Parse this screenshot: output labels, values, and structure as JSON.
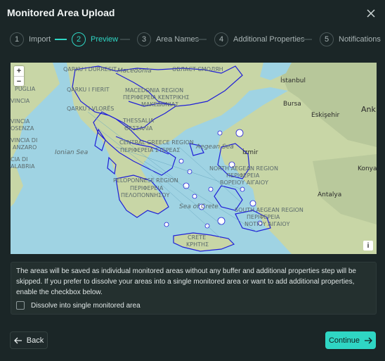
{
  "modal": {
    "title": "Monitored Area Upload"
  },
  "steps": [
    {
      "number": "1",
      "label": "Import",
      "state": "done"
    },
    {
      "number": "2",
      "label": "Preview",
      "state": "active"
    },
    {
      "number": "3",
      "label": "Area Names",
      "state": "pending"
    },
    {
      "number": "4",
      "label": "Additional Properties",
      "state": "pending"
    },
    {
      "number": "5",
      "label": "Notifications",
      "state": "pending"
    }
  ],
  "map": {
    "zoom_in": "+",
    "zoom_out": "−",
    "info": "i",
    "labels": {
      "qarku_durresit": "QARKU I DURRESIT",
      "macedonia": "Macedonia",
      "oblast": "ОБЛАСТ СМОЛЯН",
      "istanbul": "İstanbul",
      "puglia": "PUGLIA",
      "qarku_fierit": "QARKU I FIERIT",
      "macedonia_region": "MACEDONIA REGION",
      "peripheria_kentrikis": "ΠΕΡΙΦΕΡΕΙΑ ΚΕΝΤΡΙΚΗΣ",
      "makedonias": "ΜΑΚΕΔΟΝΙΑΣ",
      "bursa": "Bursa",
      "ankara": "Ank",
      "vincia": "VINCIA",
      "qarku_vlores": "QARKU I VLORËS",
      "eskisehir": "Eskişehir",
      "vincia_ta": "VINCIA",
      "osenza": "OSENZA",
      "thessalia": "THESSALIA",
      "thessalia_gr": "ΘΕΣΣΑΛΙΑ",
      "vincia_di": "VINCIA DI",
      "anzaro": "ANZARO",
      "ionian": "Ionian Sea",
      "central_greece": "CENTRAL GREECE REGION",
      "periferia_stereas": "ΠΕΡΙΦΕΡΕΙΑ ΣΤΕΡΕΑΣ",
      "aegean": "Aegean Sea",
      "izmir": "İzmir",
      "cia_di": "CIA DI",
      "alabria": "ALABRIA",
      "konya": "Konya",
      "north_aegean": "NORTH AEGEAN REGION",
      "periferia_voreiou": "ΠΕΡΙΦΕΡΕΙΑ",
      "voreiou_aigaiou": "ΒΟΡΕΙΟΥ ΑΙΓΑΙΟΥ",
      "peloponnese": "PELOPONNESE REGION",
      "periferia_pel": "ΠΕΡΙΦΕΡΕΙΑ",
      "peloponnisou": "ΠΕΛΟΠΟΝΝΗΣΟΥ",
      "antalya": "Antalya",
      "sea_crete": "Sea of Crete",
      "south_aegean": "SOUTH AEGEAN REGION",
      "periferia_notiou": "ΠΕΡΙΦΕΡΕΙΑ",
      "notiou_aigaiou": "ΝΟΤΙΟΥ ΑΙΓΑΙΟΥ",
      "crete": "CRETE",
      "crete_gr": "ΚΡΗΤΗΣ"
    }
  },
  "note": {
    "text": "The areas will be saved as individual monitored areas without any buffer and additional properties step will be skipped. If you prefer to dissolve your areas into a single monitored area or want to add additional properties, enable the checkbox below.",
    "checkbox_label": "Dissolve into single monitored area",
    "checked": false
  },
  "footer": {
    "back_label": "Back",
    "continue_label": "Continue"
  },
  "colors": {
    "accent": "#2fd6c4",
    "background": "#1b2627",
    "boundary": "#1f1fd8",
    "sea": "#9fd3e3",
    "land": "#c9d7a8"
  },
  "icons": {
    "close": "close-icon",
    "back": "arrow-left-icon",
    "continue": "arrow-right-icon"
  }
}
